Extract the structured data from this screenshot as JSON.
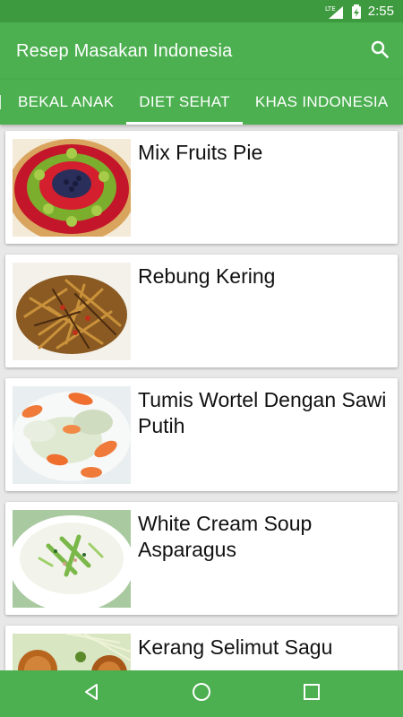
{
  "status_bar": {
    "network": "LTE",
    "time": "2:55"
  },
  "app_bar": {
    "title": "Resep Masakan Indonesia",
    "search_icon": "search-icon"
  },
  "tabs": [
    {
      "label": "",
      "active": false
    },
    {
      "label": "BEKAL ANAK",
      "active": false
    },
    {
      "label": "DIET SEHAT",
      "active": true
    },
    {
      "label": "KHAS INDONESIA",
      "active": false
    }
  ],
  "recipes": [
    {
      "title": "Mix Fruits Pie"
    },
    {
      "title": "Rebung Kering"
    },
    {
      "title": "Tumis Wortel Dengan Sawi Putih"
    },
    {
      "title": "White Cream Soup Asparagus"
    },
    {
      "title": "Kerang Selimut Sagu"
    }
  ],
  "nav_bar": {
    "back_icon": "back-icon",
    "home_icon": "home-icon",
    "recents_icon": "recents-icon"
  },
  "colors": {
    "primary": "#4caf50",
    "status_bar": "#3e9a3f",
    "background": "#e8e8e8"
  }
}
